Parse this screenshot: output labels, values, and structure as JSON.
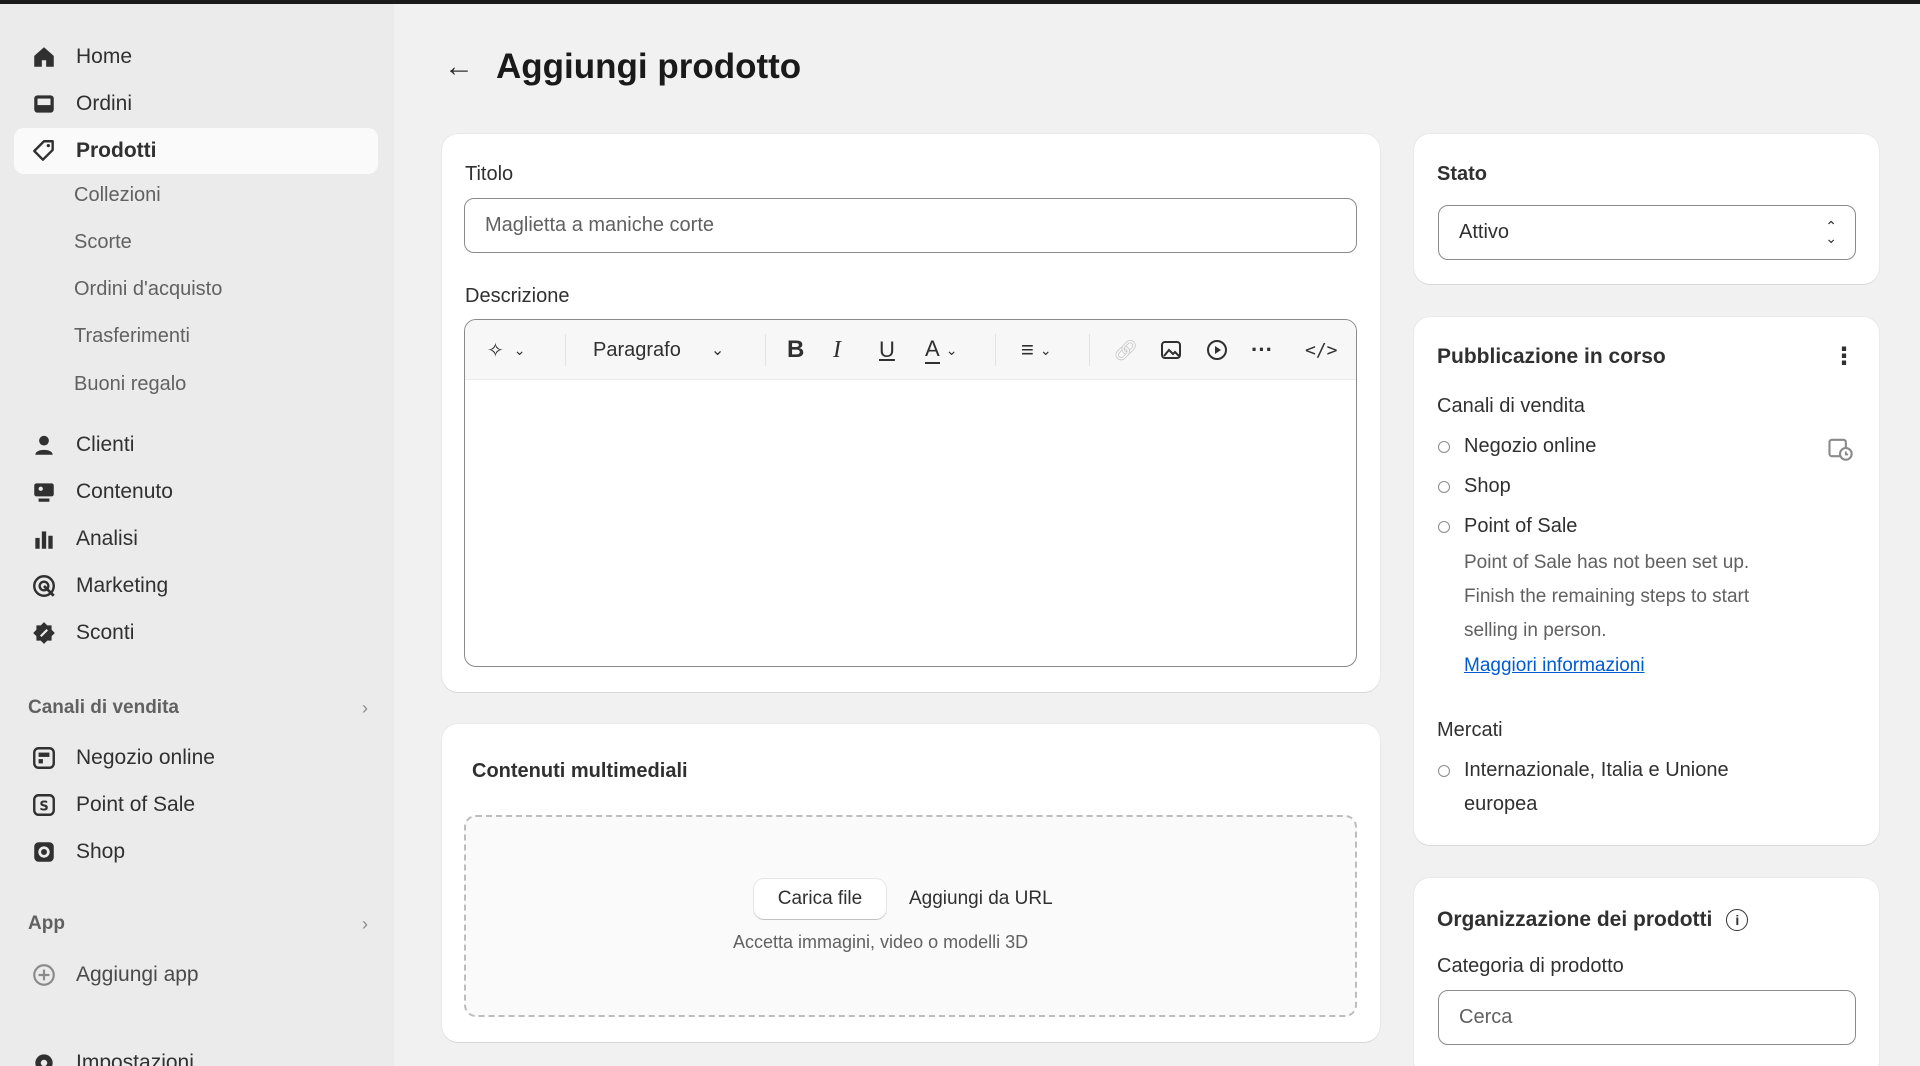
{
  "sidebar": {
    "main": [
      {
        "label": "Home",
        "icon": "home-icon"
      },
      {
        "label": "Ordini",
        "icon": "inbox-icon"
      },
      {
        "label": "Prodotti",
        "icon": "tag-icon"
      }
    ],
    "product_sub": [
      "Collezioni",
      "Scorte",
      "Ordini d'acquisto",
      "Trasferimenti",
      "Buoni regalo"
    ],
    "secondary": [
      {
        "label": "Clienti",
        "icon": "person-icon"
      },
      {
        "label": "Contenuto",
        "icon": "content-icon"
      },
      {
        "label": "Analisi",
        "icon": "bar-chart-icon"
      },
      {
        "label": "Marketing",
        "icon": "target-icon"
      },
      {
        "label": "Sconti",
        "icon": "discount-icon"
      }
    ],
    "sales_channels_title": "Canali di vendita",
    "sales_channels": [
      {
        "label": "Negozio online",
        "icon": "store-icon"
      },
      {
        "label": "Point of Sale",
        "icon": "pos-icon"
      },
      {
        "label": "Shop",
        "icon": "shop-icon"
      }
    ],
    "apps_title": "App",
    "add_app": "Aggiungi app",
    "settings": "Impostazioni"
  },
  "header": {
    "title": "Aggiungi prodotto"
  },
  "product": {
    "title_label": "Titolo",
    "title_placeholder": "Maglietta a maniche corte",
    "description_label": "Descrizione",
    "paragraph_label": "Paragrafo"
  },
  "media": {
    "title": "Contenuti multimediali",
    "upload_button": "Carica file",
    "url_button": "Aggiungi da URL",
    "hint": "Accetta immagini, video o modelli 3D"
  },
  "status": {
    "label": "Stato",
    "value": "Attivo"
  },
  "publishing": {
    "title": "Pubblicazione in corso",
    "channels_label": "Canali di vendita",
    "channels": [
      "Negozio online",
      "Shop",
      "Point of Sale"
    ],
    "pos_note_lines": [
      "Point of Sale has not been set up.",
      "Finish the remaining steps to start",
      "selling in person."
    ],
    "learn_more": "Maggiori informazioni",
    "markets_label": "Mercati",
    "markets_lines": [
      "Internazionale, Italia e Unione",
      "europea"
    ]
  },
  "organization": {
    "title": "Organizzazione dei prodotti",
    "category_label": "Categoria di prodotto",
    "category_placeholder": "Cerca"
  },
  "colors": {
    "accent_link": "#005bd3",
    "sidebar_bg": "#ebebeb",
    "page_bg": "#f1f1f1"
  }
}
